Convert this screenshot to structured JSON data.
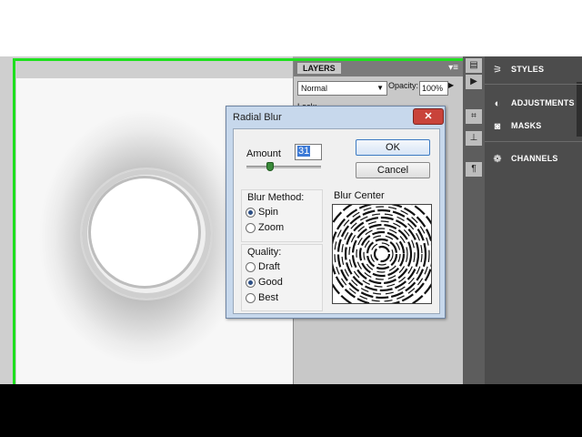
{
  "layers_panel": {
    "tab": "LAYERS",
    "blend_mode": "Normal",
    "opacity_label": "Opacity:",
    "opacity_value": "100%",
    "lock_label": "Lock:"
  },
  "right_panel": {
    "items": [
      {
        "label": "STYLES",
        "icon": "styles-icon"
      },
      {
        "label": "ADJUSTMENTS",
        "icon": "adjustments-icon"
      },
      {
        "label": "MASKS",
        "icon": "masks-icon"
      },
      {
        "label": "CHANNELS",
        "icon": "channels-icon"
      }
    ]
  },
  "dialog": {
    "title": "Radial Blur",
    "close_glyph": "✕",
    "amount_label": "Amount",
    "amount_value": "31",
    "amount_slider_max": 100,
    "ok_label": "OK",
    "cancel_label": "Cancel",
    "blur_method_label": "Blur Method:",
    "blur_methods": [
      "Spin",
      "Zoom"
    ],
    "selected_method": "Spin",
    "quality_label": "Quality:",
    "qualities": [
      "Draft",
      "Good",
      "Best"
    ],
    "selected_quality": "Good",
    "blur_center_label": "Blur Center"
  },
  "colors": {
    "selection_outline": "#1ee01e",
    "dialog_frame": "#c7d8ec",
    "close_button": "#c9433a",
    "right_panel": "#4c4c4c"
  }
}
